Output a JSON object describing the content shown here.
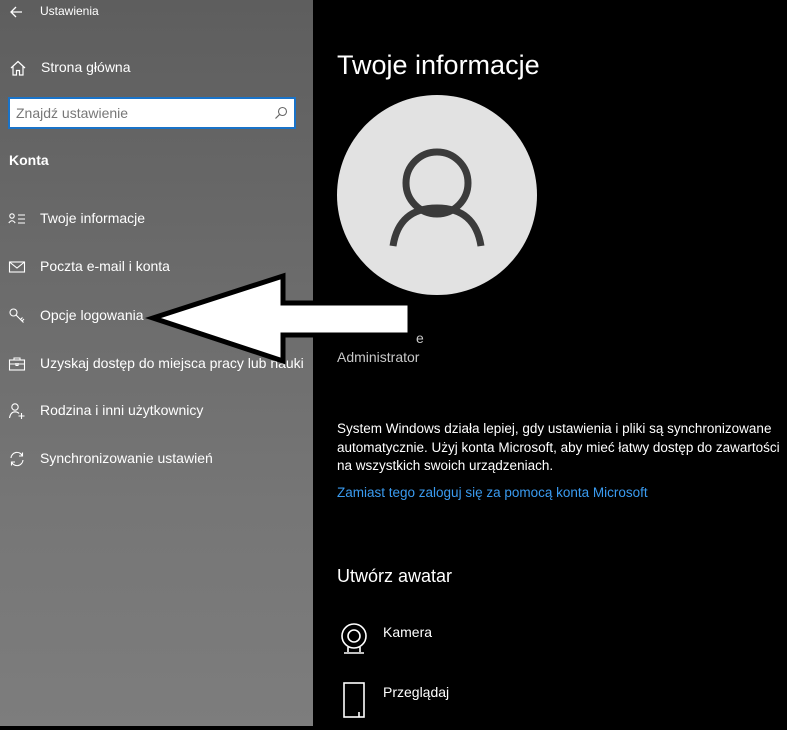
{
  "app": {
    "title": "Ustawienia"
  },
  "sidebar": {
    "home_label": "Strona główna",
    "search": {
      "placeholder": "Znajdź ustawienie",
      "value": ""
    },
    "section_title": "Konta",
    "items": [
      {
        "label": "Twoje informacje",
        "icon": "user-info-icon"
      },
      {
        "label": "Poczta e-mail i konta",
        "icon": "mail-icon"
      },
      {
        "label": "Opcje logowania",
        "icon": "key-icon"
      },
      {
        "label": "Uzyskaj dostęp do miejsca pracy lub nauki",
        "icon": "briefcase-icon"
      },
      {
        "label": "Rodzina i inni użytkownicy",
        "icon": "person-add-icon"
      },
      {
        "label": "Synchronizowanie ustawień",
        "icon": "sync-icon"
      }
    ]
  },
  "main": {
    "title": "Twoje informacje",
    "user_name_visible": "e",
    "account_type": "Administrator",
    "sync_text": "System Windows działa lepiej, gdy ustawienia i pliki są synchronizowane automatycznie. Użyj konta Microsoft, aby mieć łatwy dostęp do zawartości na wszystkich swoich urządzeniach.",
    "ms_link": "Zamiast tego zaloguj się za pomocą konta Microsoft",
    "create_avatar_title": "Utwórz awatar",
    "avatar_options": [
      {
        "label": "Kamera",
        "icon": "camera-icon"
      },
      {
        "label": "Przeglądaj",
        "icon": "browse-icon"
      }
    ]
  },
  "colors": {
    "accent": "#1a73c8",
    "link": "#3a9bf0",
    "main_background": "#000000",
    "sidebar_background": "#6a6a6a",
    "avatar_background": "#e2e2e2"
  }
}
